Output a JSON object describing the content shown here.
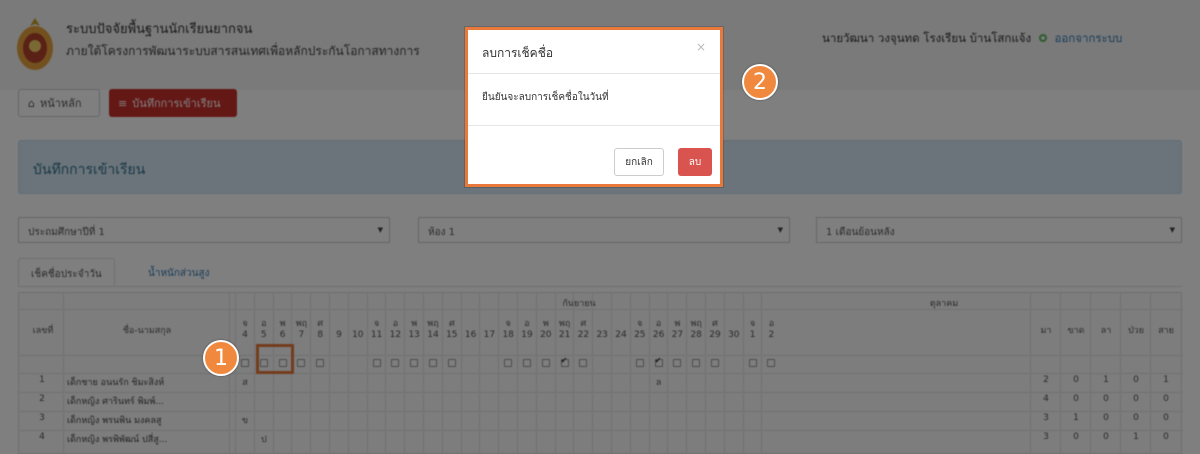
{
  "header": {
    "system_title": "ระบบปัจจัยพื้นฐานนักเรียนยากจน",
    "system_subtitle": "ภายใต้โครงการพัฒนาระบบสารสนเทศเพื่อหลักประกันโอกาสทางการ",
    "user_name": "นายวัฒนา วงจุนทด",
    "school": "โรงเรียน บ้านโสกแจ้ง",
    "logout_label": "ออกจากระบบ"
  },
  "nav": {
    "home_label": "หน้าหลัก",
    "attendance_label": "บันทึกการเข้าเรียน"
  },
  "panel": {
    "title": "บันทึกการเข้าเรียน"
  },
  "filters": {
    "year": "ประถมศึกษาปีที่ 1",
    "room": "ห้อง 1",
    "period": "1 เดือนย้อนหลัง"
  },
  "tabs": {
    "daily": "เช็คชื่อประจำวัน",
    "weight": "น้ำหนักส่วนสูง"
  },
  "table": {
    "col_no": "เลขที่",
    "col_name": "ชื่อ-นามสกุล",
    "month1": "กันยายน",
    "month2": "ตุลาคม",
    "weekday_letters": [
      "จ",
      "อ",
      "พ",
      "พฤ",
      "ศ"
    ],
    "days": [
      "4",
      "5",
      "6",
      "7",
      "8",
      "9",
      "10",
      "11",
      "12",
      "13",
      "14",
      "15",
      "16",
      "17",
      "18",
      "19",
      "20",
      "21",
      "22",
      "23",
      "24",
      "25",
      "26",
      "27",
      "28",
      "29",
      "30",
      "1",
      "2"
    ],
    "summary_headers": [
      "มา",
      "ขาด",
      "ลา",
      "ป่วย",
      "สาย"
    ],
    "rows": [
      {
        "no": "1",
        "name": "เด็กชาย อนนรัก ชิมะสิงห์",
        "marks": [
          "ส",
          "",
          "",
          "",
          "",
          "",
          "",
          "",
          "",
          "",
          "",
          "",
          "",
          "",
          "",
          "",
          "",
          "",
          "",
          "",
          "",
          "",
          "ล",
          "",
          "",
          "",
          "",
          "",
          ""
        ],
        "summary": [
          "2",
          "0",
          "1",
          "0",
          "1"
        ]
      },
      {
        "no": "2",
        "name": "เด็กหญิง ศารินทร์ พิมพ์...",
        "marks": [
          "",
          "",
          "",
          "",
          "",
          "",
          "",
          "",
          "",
          "",
          "",
          "",
          "",
          "",
          "",
          "",
          "",
          "",
          "",
          "",
          "",
          "",
          "",
          "",
          "",
          "",
          "",
          "",
          ""
        ],
        "summary": [
          "4",
          "0",
          "0",
          "0",
          "0"
        ]
      },
      {
        "no": "3",
        "name": "เด็กหญิง พรนพิน มงคลสู",
        "marks": [
          "ข",
          "",
          "",
          "",
          "",
          "",
          "",
          "",
          "",
          "",
          "",
          "",
          "",
          "",
          "",
          "",
          "",
          "",
          "",
          "",
          "",
          "",
          "",
          "",
          "",
          "",
          "",
          "",
          ""
        ],
        "summary": [
          "3",
          "1",
          "0",
          "0",
          "0"
        ]
      },
      {
        "no": "4",
        "name": "เด็กหญิง พรพิพัฒน์ ปสี่สู...",
        "marks": [
          "",
          "ป",
          "",
          "",
          "",
          "",
          "",
          "",
          "",
          "",
          "",
          "",
          "",
          "",
          "",
          "",
          "",
          "",
          "",
          "",
          "",
          "",
          "",
          "",
          "",
          "",
          "",
          "",
          ""
        ],
        "summary": [
          "3",
          "0",
          "0",
          "1",
          "0"
        ]
      }
    ]
  },
  "modal": {
    "title": "ลบการเช็คชื่อ",
    "close": "×",
    "message": "ยืนยันจะลบการเช็คชื่อในวันที่",
    "cancel_label": "ยกเลิก",
    "delete_label": "ลบ"
  },
  "callouts": {
    "step1": "1",
    "step2": "2"
  },
  "colors": {
    "accent_orange": "#e8793a",
    "danger": "#d9534f",
    "info_panel": "#d7e9f4",
    "link": "#337ab7"
  }
}
